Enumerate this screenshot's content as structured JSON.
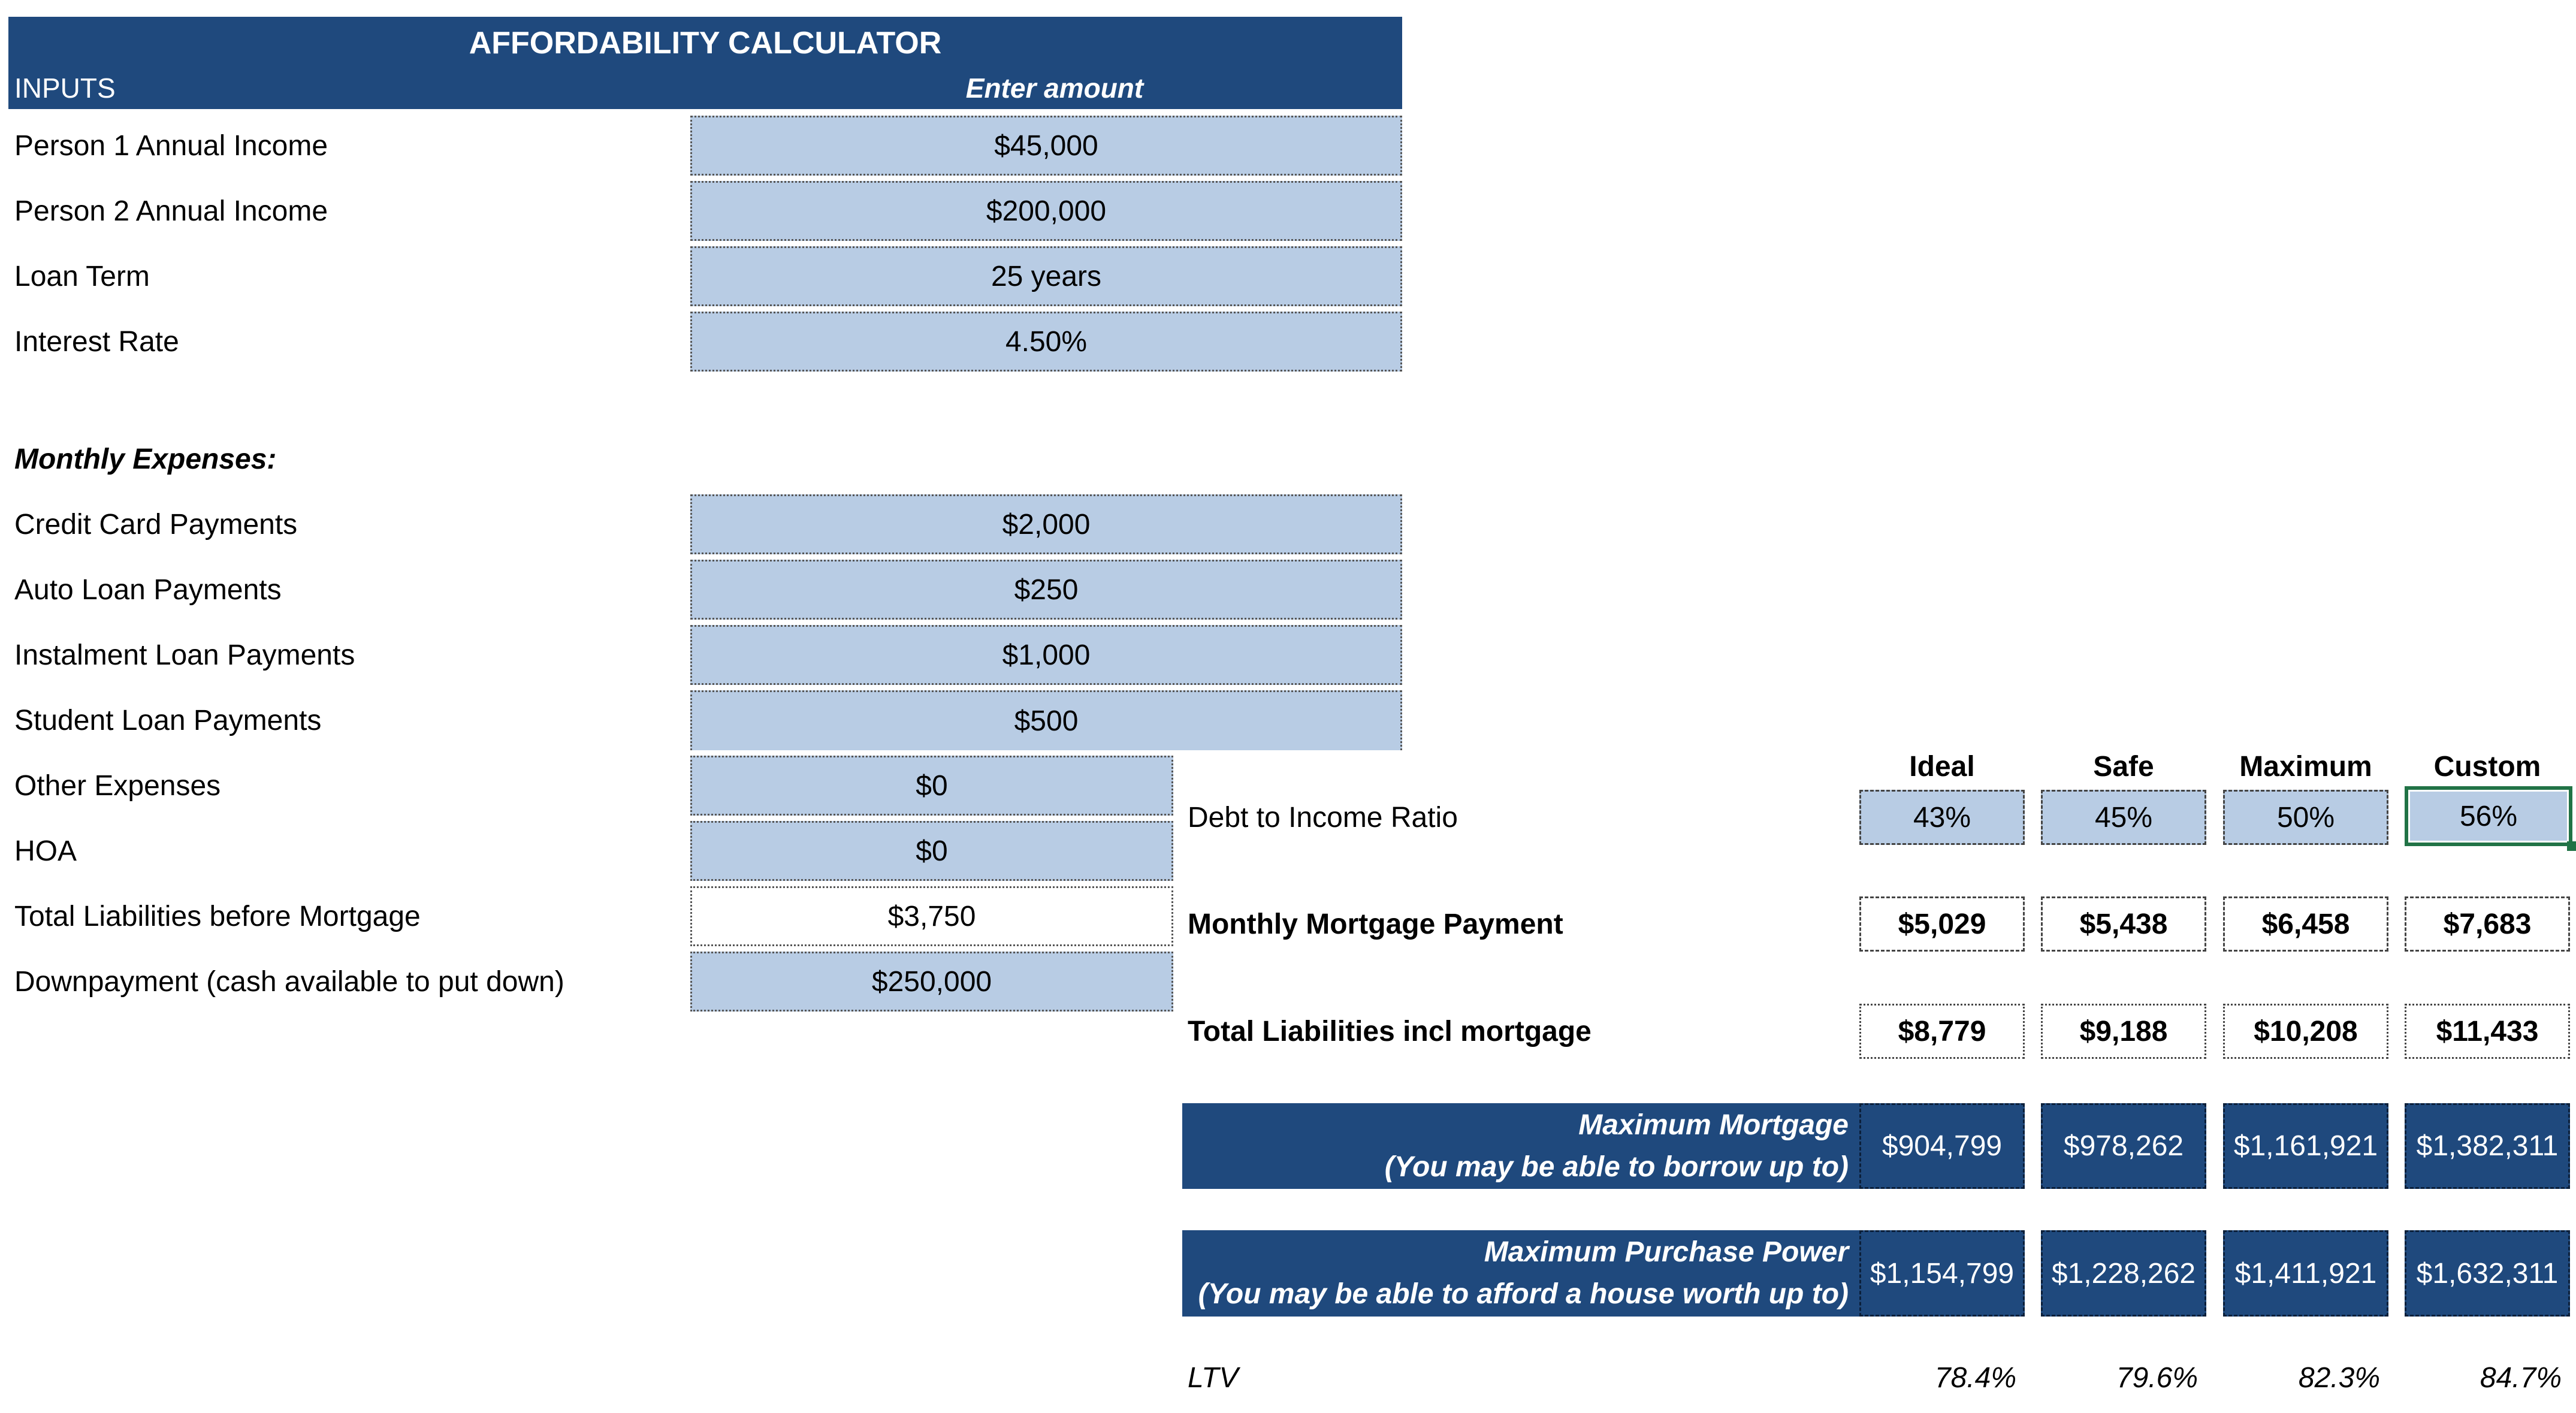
{
  "header": {
    "title": "AFFORDABILITY CALCULATOR",
    "inputs_label": "INPUTS",
    "enter_amount_label": "Enter amount"
  },
  "inputs": [
    {
      "label": "Person 1 Annual Income",
      "value": "$45,000"
    },
    {
      "label": "Person 2 Annual Income",
      "value": "$200,000"
    },
    {
      "label": "Loan Term",
      "value": "25 years"
    },
    {
      "label": "Interest Rate",
      "value": "4.50%"
    }
  ],
  "monthly_expenses_heading": "Monthly Expenses:",
  "expenses": [
    {
      "label": "Credit Card Payments",
      "value": "$2,000"
    },
    {
      "label": "Auto Loan Payments",
      "value": "$250"
    },
    {
      "label": "Instalment Loan Payments",
      "value": "$1,000"
    },
    {
      "label": "Student Loan Payments",
      "value": "$500"
    },
    {
      "label": "Other Expenses",
      "value": "$0"
    },
    {
      "label": "HOA",
      "value": "$0"
    },
    {
      "label": "Total Liabilities before Mortgage",
      "value": "$3,750"
    },
    {
      "label": "Downpayment (cash available to put down)",
      "value": "$250,000"
    }
  ],
  "scenarios": {
    "columns": [
      "Ideal",
      "Safe",
      "Maximum",
      "Custom"
    ],
    "dti": {
      "label": "Debt to Income Ratio",
      "values": [
        "43%",
        "45%",
        "50%",
        "56%"
      ]
    },
    "monthly_payment": {
      "label": "Monthly Mortgage Payment",
      "values": [
        "$5,029",
        "$5,438",
        "$6,458",
        "$7,683"
      ]
    },
    "total_liabilities": {
      "label": "Total Liabilities incl mortgage",
      "values": [
        "$8,779",
        "$9,188",
        "$10,208",
        "$11,433"
      ]
    },
    "max_mortgage": {
      "label_line1": "Maximum Mortgage",
      "label_line2": "(You may be able to borrow up to)",
      "values": [
        "$904,799",
        "$978,262",
        "$1,161,921",
        "$1,382,311"
      ]
    },
    "max_purchase": {
      "label_line1": "Maximum Purchase Power",
      "label_line2": "(You may be able to afford a house worth up to)",
      "values": [
        "$1,154,799",
        "$1,228,262",
        "$1,411,921",
        "$1,632,311"
      ]
    },
    "ltv": {
      "label": "LTV",
      "values": [
        "78.4%",
        "79.6%",
        "82.3%",
        "84.7%"
      ]
    }
  },
  "colors": {
    "header_navy": "#1f497d",
    "input_blue": "#b8cce4",
    "selection_green": "#217346"
  }
}
